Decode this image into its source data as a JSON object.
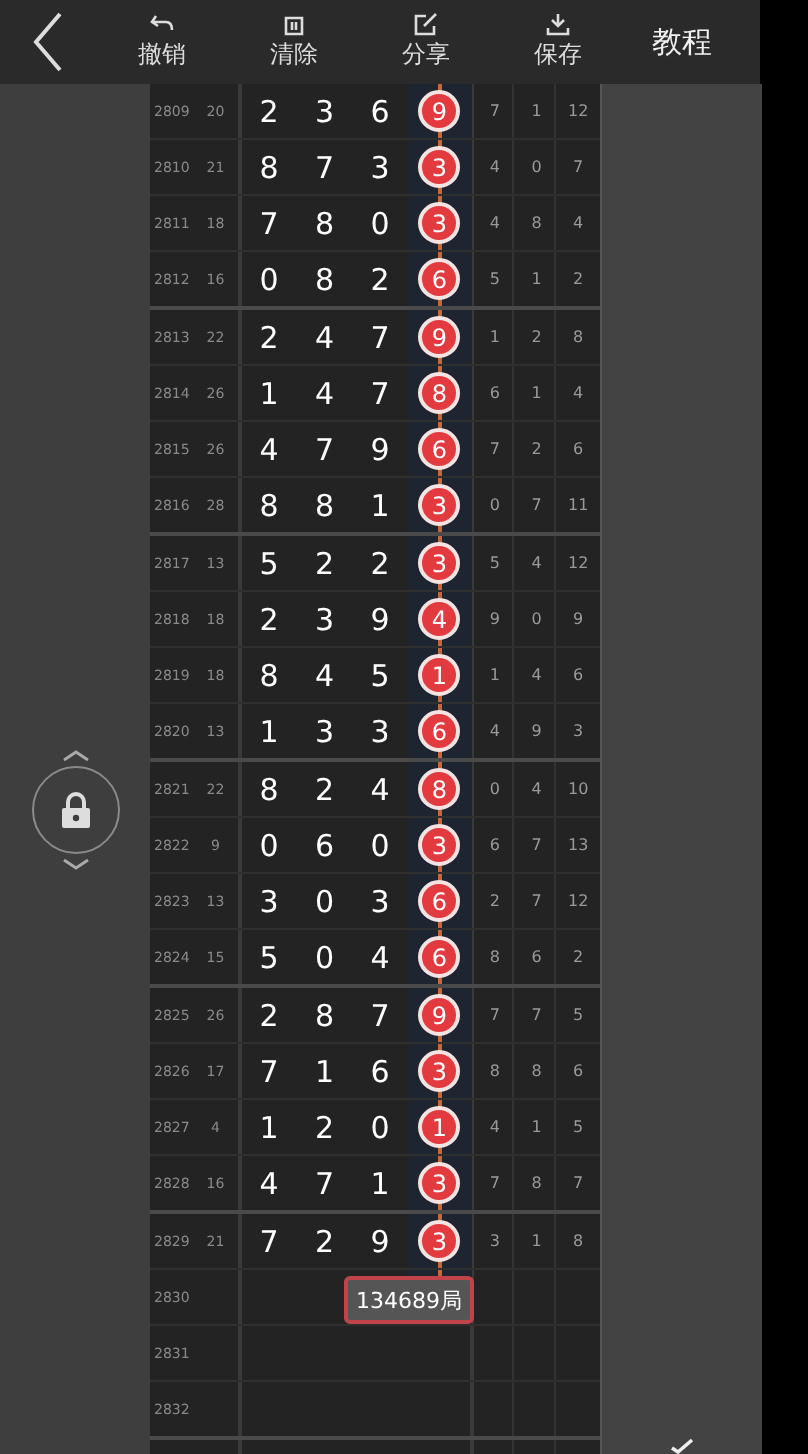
{
  "toolbar": {
    "buttons": [
      {
        "label": "撤销",
        "kind": "undo"
      },
      {
        "label": "清除",
        "kind": "clear"
      },
      {
        "label": "分享",
        "kind": "share"
      },
      {
        "label": "保存",
        "kind": "save"
      }
    ],
    "tutorial": "教程"
  },
  "rows": [
    {
      "issue": "2809",
      "span": "20",
      "digits": [
        "2",
        "3",
        "6"
      ],
      "ball": "9",
      "tail": [
        "7",
        "1",
        "12"
      ]
    },
    {
      "issue": "2810",
      "span": "21",
      "digits": [
        "8",
        "7",
        "3"
      ],
      "ball": "3",
      "tail": [
        "4",
        "0",
        "7"
      ]
    },
    {
      "issue": "2811",
      "span": "18",
      "digits": [
        "7",
        "8",
        "0"
      ],
      "ball": "3",
      "tail": [
        "4",
        "8",
        "4"
      ]
    },
    {
      "issue": "2812",
      "span": "16",
      "digits": [
        "0",
        "8",
        "2"
      ],
      "ball": "6",
      "tail": [
        "5",
        "1",
        "2"
      ]
    },
    {
      "issue": "2813",
      "span": "22",
      "digits": [
        "2",
        "4",
        "7"
      ],
      "ball": "9",
      "tail": [
        "1",
        "2",
        "8"
      ]
    },
    {
      "issue": "2814",
      "span": "26",
      "digits": [
        "1",
        "4",
        "7"
      ],
      "ball": "8",
      "tail": [
        "6",
        "1",
        "4"
      ]
    },
    {
      "issue": "2815",
      "span": "26",
      "digits": [
        "4",
        "7",
        "9"
      ],
      "ball": "6",
      "tail": [
        "7",
        "2",
        "6"
      ]
    },
    {
      "issue": "2816",
      "span": "28",
      "digits": [
        "8",
        "8",
        "1"
      ],
      "ball": "3",
      "tail": [
        "0",
        "7",
        "11"
      ]
    },
    {
      "issue": "2817",
      "span": "13",
      "digits": [
        "5",
        "2",
        "2"
      ],
      "ball": "3",
      "tail": [
        "5",
        "4",
        "12"
      ]
    },
    {
      "issue": "2818",
      "span": "18",
      "digits": [
        "2",
        "3",
        "9"
      ],
      "ball": "4",
      "tail": [
        "9",
        "0",
        "9"
      ]
    },
    {
      "issue": "2819",
      "span": "18",
      "digits": [
        "8",
        "4",
        "5"
      ],
      "ball": "1",
      "tail": [
        "1",
        "4",
        "6"
      ]
    },
    {
      "issue": "2820",
      "span": "13",
      "digits": [
        "1",
        "3",
        "3"
      ],
      "ball": "6",
      "tail": [
        "4",
        "9",
        "3"
      ]
    },
    {
      "issue": "2821",
      "span": "22",
      "digits": [
        "8",
        "2",
        "4"
      ],
      "ball": "8",
      "tail": [
        "0",
        "4",
        "10"
      ]
    },
    {
      "issue": "2822",
      "span": "9",
      "digits": [
        "0",
        "6",
        "0"
      ],
      "ball": "3",
      "tail": [
        "6",
        "7",
        "13"
      ]
    },
    {
      "issue": "2823",
      "span": "13",
      "digits": [
        "3",
        "0",
        "3"
      ],
      "ball": "6",
      "tail": [
        "2",
        "7",
        "12"
      ]
    },
    {
      "issue": "2824",
      "span": "15",
      "digits": [
        "5",
        "0",
        "4"
      ],
      "ball": "6",
      "tail": [
        "8",
        "6",
        "2"
      ]
    },
    {
      "issue": "2825",
      "span": "26",
      "digits": [
        "2",
        "8",
        "7"
      ],
      "ball": "9",
      "tail": [
        "7",
        "7",
        "5"
      ]
    },
    {
      "issue": "2826",
      "span": "17",
      "digits": [
        "7",
        "1",
        "6"
      ],
      "ball": "3",
      "tail": [
        "8",
        "8",
        "6"
      ]
    },
    {
      "issue": "2827",
      "span": "4",
      "digits": [
        "1",
        "2",
        "0"
      ],
      "ball": "1",
      "tail": [
        "4",
        "1",
        "5"
      ]
    },
    {
      "issue": "2828",
      "span": "16",
      "digits": [
        "4",
        "7",
        "1"
      ],
      "ball": "3",
      "tail": [
        "7",
        "8",
        "7"
      ]
    },
    {
      "issue": "2829",
      "span": "21",
      "digits": [
        "7",
        "2",
        "9"
      ],
      "ball": "3",
      "tail": [
        "3",
        "1",
        "8"
      ]
    },
    {
      "issue": "2830",
      "popup": "134689局"
    },
    {
      "issue": "2831"
    },
    {
      "issue": "2832"
    }
  ]
}
